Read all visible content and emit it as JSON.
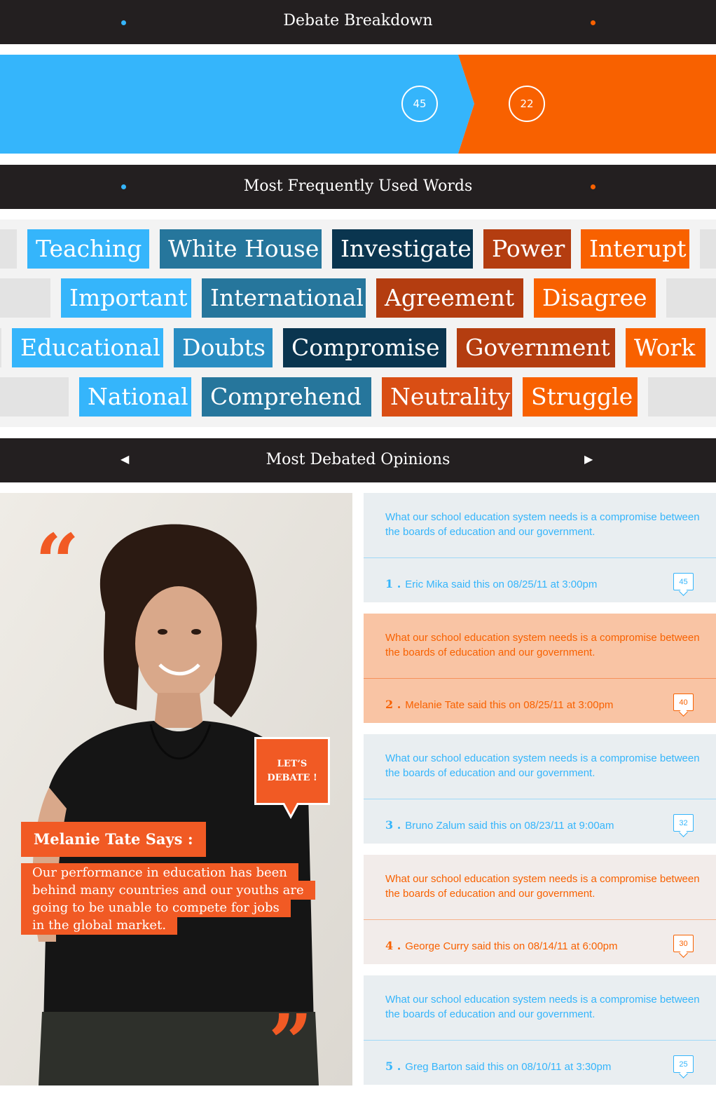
{
  "header": {
    "title": "Debate Breakdown"
  },
  "breakdown": {
    "left_score": "45",
    "right_score": "22",
    "left_color": "#35b5fb",
    "right_color": "#f86100"
  },
  "words_header": {
    "title": "Most Frequently Used Words"
  },
  "words": {
    "rows": [
      [
        {
          "label": "Teaching",
          "color": "#35b5fb"
        },
        {
          "label": "White House",
          "color": "#26769c"
        },
        {
          "label": "Investigate",
          "color": "#0a354f"
        },
        {
          "label": "Power",
          "color": "#b43d10"
        },
        {
          "label": "Interupt",
          "color": "#f86100"
        }
      ],
      [
        {
          "label": "Important",
          "color": "#35b5fb"
        },
        {
          "label": "International",
          "color": "#26769c"
        },
        {
          "label": "Agreement",
          "color": "#b43d10"
        },
        {
          "label": "Disagree",
          "color": "#f86100"
        }
      ],
      [
        {
          "label": "Educational",
          "color": "#35b5fb"
        },
        {
          "label": "Doubts",
          "color": "#2a8ec3"
        },
        {
          "label": "Compromise",
          "color": "#0a354f"
        },
        {
          "label": "Government",
          "color": "#b43d10"
        },
        {
          "label": "Work",
          "color": "#f86100"
        }
      ],
      [
        {
          "label": "National",
          "color": "#35b5fb"
        },
        {
          "label": "Comprehend",
          "color": "#26769c"
        },
        {
          "label": "Neutrality",
          "color": "#d94e14"
        },
        {
          "label": "Struggle",
          "color": "#f86100"
        }
      ]
    ]
  },
  "opinions_header": {
    "title": "Most Debated Opinions",
    "prev_icon": "triangle-left-icon",
    "next_icon": "triangle-right-icon"
  },
  "featured": {
    "speech_line1": "LET’S",
    "speech_line2": "DEBATE !",
    "speaker": "Melanie Tate Says :",
    "quote_lines": [
      "Our performance in education has been",
      "behind many countries and our youths are",
      "going to be unable to compete for jobs",
      "in the global market."
    ]
  },
  "opinions": [
    {
      "rank": "1 .",
      "text": "What our school education system needs is a compromise between the boards of education and our government.",
      "meta": "Eric Mika said this on 08/25/11 at 3:00pm",
      "comments": "45",
      "bg": "#e9eef1",
      "fg": "#35b5fb",
      "line": "#9fd9f7"
    },
    {
      "rank": "2 .",
      "text": "What our school education system needs is a compromise between the boards of education and our government.",
      "meta": "Melanie Tate said this on 08/25/11 at 3:00pm",
      "comments": "40",
      "bg": "#f9c4a4",
      "fg": "#f86100",
      "line": "#f6915a"
    },
    {
      "rank": "3 .",
      "text": "What our school education system needs is a compromise between the boards of education and our government.",
      "meta": "Bruno Zalum said this on 08/23/11 at 9:00am",
      "comments": "32",
      "bg": "#e9eef1",
      "fg": "#35b5fb",
      "line": "#9fd9f7"
    },
    {
      "rank": "4 .",
      "text": "What our school education system needs is a compromise between the boards of education and our government.",
      "meta": "George Curry said this on 08/14/11 at 6:00pm",
      "comments": "30",
      "bg": "#f2ecea",
      "fg": "#f86100",
      "line": "#f6b28a"
    },
    {
      "rank": "5 .",
      "text": "What our school education system needs is a compromise between the boards of education and our government.",
      "meta": "Greg Barton said this on 08/10/11 at 3:30pm",
      "comments": "25",
      "bg": "#e9eef1",
      "fg": "#35b5fb",
      "line": "#9fd9f7"
    }
  ]
}
